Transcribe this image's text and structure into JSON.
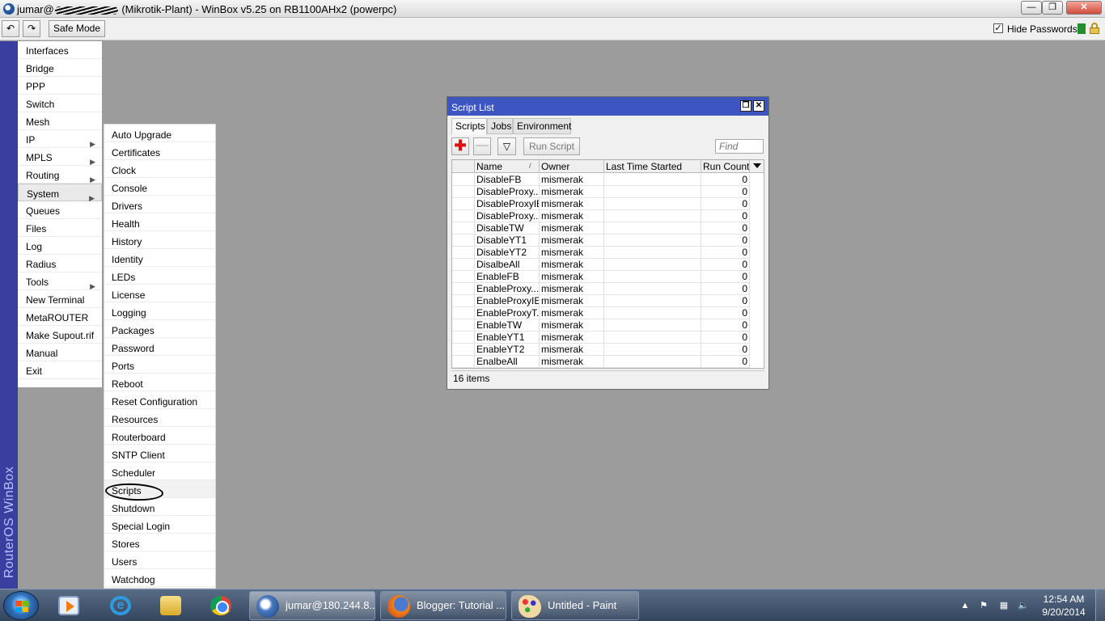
{
  "window": {
    "title_prefix": "jumar@",
    "title_suffix": " (Mikrotik-Plant) - WinBox v5.25 on RB1100AHx2 (powerpc)",
    "minimize_glyph": "—",
    "maximize_glyph": "❐",
    "close_glyph": "✕"
  },
  "toolbar": {
    "undo_glyph": "↶",
    "redo_glyph": "↷",
    "safe_mode": "Safe Mode",
    "hide_passwords": "Hide Passwords",
    "hide_passwords_checked": true,
    "check_glyph": "✓"
  },
  "brand": {
    "text": "RouterOS WinBox"
  },
  "main_menu": {
    "items": [
      {
        "label": "Interfaces",
        "submenu": false
      },
      {
        "label": "Bridge",
        "submenu": false
      },
      {
        "label": "PPP",
        "submenu": false
      },
      {
        "label": "Switch",
        "submenu": false
      },
      {
        "label": "Mesh",
        "submenu": false
      },
      {
        "label": "IP",
        "submenu": true
      },
      {
        "label": "MPLS",
        "submenu": true
      },
      {
        "label": "Routing",
        "submenu": true
      },
      {
        "label": "System",
        "submenu": true,
        "active": true
      },
      {
        "label": "Queues",
        "submenu": false
      },
      {
        "label": "Files",
        "submenu": false
      },
      {
        "label": "Log",
        "submenu": false
      },
      {
        "label": "Radius",
        "submenu": false
      },
      {
        "label": "Tools",
        "submenu": true
      },
      {
        "label": "New Terminal",
        "submenu": false
      },
      {
        "label": "MetaROUTER",
        "submenu": false
      },
      {
        "label": "Make Supout.rif",
        "submenu": false
      },
      {
        "label": "Manual",
        "submenu": false
      },
      {
        "label": "Exit",
        "submenu": false
      }
    ],
    "arrow_glyph": "▶"
  },
  "system_submenu": {
    "items": [
      "Auto Upgrade",
      "Certificates",
      "Clock",
      "Console",
      "Drivers",
      "Health",
      "History",
      "Identity",
      "LEDs",
      "License",
      "Logging",
      "Packages",
      "Password",
      "Ports",
      "Reboot",
      "Reset Configuration",
      "Resources",
      "Routerboard",
      "SNTP Client",
      "Scheduler",
      "Scripts",
      "Shutdown",
      "Special Login",
      "Stores",
      "Users",
      "Watchdog"
    ],
    "highlighted": "Scripts"
  },
  "script_list": {
    "title": "Script List",
    "tabs": [
      {
        "label": "Scripts",
        "active": true
      },
      {
        "label": "Jobs",
        "active": false
      },
      {
        "label": "Environment",
        "active": false
      }
    ],
    "add_glyph": "✚",
    "remove_glyph": "—",
    "filter_glyph": "▽",
    "run_script": "Run Script",
    "find_placeholder": "Find",
    "columns": {
      "name": "Name",
      "owner": "Owner",
      "last_time_started": "Last Time Started",
      "run_count": "Run Count"
    },
    "sort_glyph": "/",
    "rows": [
      {
        "name": "DisableFB",
        "owner": "mismerak",
        "last": "",
        "count": "0"
      },
      {
        "name": "DisableProxy...",
        "owner": "mismerak",
        "last": "",
        "count": "0"
      },
      {
        "name": "DisableProxyIEI",
        "owner": "mismerak",
        "last": "",
        "count": "0"
      },
      {
        "name": "DisableProxy...",
        "owner": "mismerak",
        "last": "",
        "count": "0"
      },
      {
        "name": "DisableTW",
        "owner": "mismerak",
        "last": "",
        "count": "0"
      },
      {
        "name": "DisableYT1",
        "owner": "mismerak",
        "last": "",
        "count": "0"
      },
      {
        "name": "DisableYT2",
        "owner": "mismerak",
        "last": "",
        "count": "0"
      },
      {
        "name": "DisalbeAll",
        "owner": "mismerak",
        "last": "",
        "count": "0"
      },
      {
        "name": "EnableFB",
        "owner": "mismerak",
        "last": "",
        "count": "0"
      },
      {
        "name": "EnableProxy...",
        "owner": "mismerak",
        "last": "",
        "count": "0"
      },
      {
        "name": "EnableProxyIEI",
        "owner": "mismerak",
        "last": "",
        "count": "0"
      },
      {
        "name": "EnableProxyT...",
        "owner": "mismerak",
        "last": "",
        "count": "0"
      },
      {
        "name": "EnableTW",
        "owner": "mismerak",
        "last": "",
        "count": "0"
      },
      {
        "name": "EnableYT1",
        "owner": "mismerak",
        "last": "",
        "count": "0"
      },
      {
        "name": "EnableYT2",
        "owner": "mismerak",
        "last": "",
        "count": "0"
      },
      {
        "name": "EnalbeAll",
        "owner": "mismerak",
        "last": "",
        "count": "0"
      }
    ],
    "status": "16 items"
  },
  "taskbar": {
    "tasks": [
      {
        "label": "jumar@180.244.8...",
        "icon": "winbox-icon",
        "active": true
      },
      {
        "label": "Blogger: Tutorial ...",
        "icon": "firefox-icon",
        "active": false
      },
      {
        "label": "Untitled - Paint",
        "icon": "paint-icon",
        "active": false
      }
    ],
    "pinned": [
      "media-player-icon",
      "internet-explorer-icon",
      "file-explorer-icon",
      "chrome-icon"
    ],
    "ie_glyph": "e",
    "tray": {
      "arrow_glyph": "▲",
      "flag_glyph": "⚑",
      "network_glyph": "▦",
      "volume_glyph": "🔈"
    },
    "clock": {
      "time": "12:54 AM",
      "date": "9/20/2014"
    }
  }
}
